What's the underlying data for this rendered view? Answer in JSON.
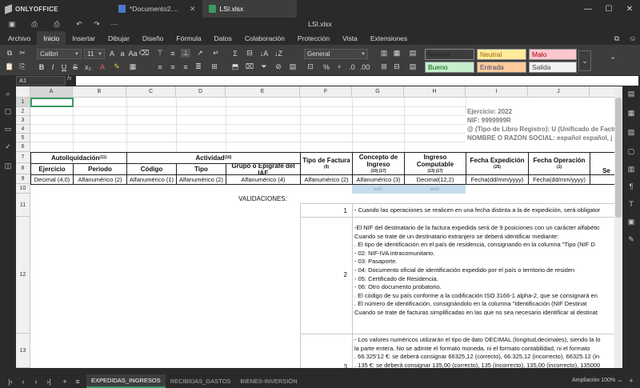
{
  "app": {
    "name": "ONLYOFFICE"
  },
  "tabs": [
    {
      "label": "*Documento2....",
      "active": false,
      "color": "#4a78c8"
    },
    {
      "label": "LSI.xlsx",
      "active": true,
      "color": "#3a9a5f"
    }
  ],
  "document_title": "LSI.xlsx",
  "menu": [
    "Archivo",
    "Inicio",
    "Insertar",
    "Dibujar",
    "Diseño",
    "Fórmula",
    "Datos",
    "Colaboración",
    "Protección",
    "Vista",
    "Extensiones"
  ],
  "menu_active": "Inicio",
  "ribbon": {
    "font_name": "Calibri",
    "font_size": "11",
    "number_format": "General",
    "styles": [
      {
        "label": "Normal",
        "bg": "#ffffff"
      },
      {
        "label": "Neutral",
        "bg": "#ffeb9c"
      },
      {
        "label": "Malo",
        "bg": "#ffc7ce"
      },
      {
        "label": "Bueno",
        "bg": "#c6efce"
      },
      {
        "label": "Entrada",
        "bg": "#ffcc99"
      },
      {
        "label": "Salida",
        "bg": "#f2f2f2"
      }
    ]
  },
  "formula_bar": {
    "name_box": "A1",
    "fx": "fx",
    "value": ""
  },
  "columns": [
    "A",
    "B",
    "C",
    "D",
    "E",
    "F",
    "G",
    "H",
    "I",
    "J"
  ],
  "rows": [
    "1",
    "2",
    "3",
    "4",
    "5",
    "6",
    "7",
    "8",
    "9",
    "10",
    "11",
    "12",
    "13"
  ],
  "sheet": {
    "info": {
      "ejercicio": "Ejercicio: 2022",
      "nif": "NIF: 9999999R",
      "tipo_libro": "@ (Tipo de Libro Registro): U (Unificado de Factu",
      "nombre": "NOMBRE O RAZÓN SOCIAL: español español, j"
    },
    "groups": {
      "autoliquidacion": "Autoliquidación",
      "autoliquidacion_sup": "(11)",
      "actividad": "Actividad",
      "actividad_sup": "(16)"
    },
    "headers": {
      "tipo_factura": "Tipo de Factura",
      "tipo_factura_sup": "(9)",
      "concepto": "Concepto de Ingreso",
      "concepto_sup": "(10) (17)",
      "ingreso": "Ingreso Computable",
      "ingreso_sup": "(13) (17)",
      "fecha_exp": "Fecha Expedición",
      "fecha_exp_sup": "(25)",
      "fecha_op": "Fecha Operación",
      "fecha_op_sup": "(1)",
      "ejercicio": "Ejercicio",
      "periodo": "Periodo",
      "codigo": "Código",
      "tipo": "Tipo",
      "grupo": "Grupo o Epígrafe del IAE",
      "cut": "Se"
    },
    "formats": [
      "Decimal (4,0)",
      "Alfanumérico (2)",
      "Alfanumérico (1)",
      "Alfanumérico (2)",
      "Alfanumérico (4)",
      "Alfanumérico (2)",
      "Alfanumérico (3)",
      "Decimal(12,2)",
      "Fecha(dd/mm/yyyy)",
      "Fecha(dd/mm/yyyy)"
    ],
    "row10": [
      "auto",
      "auto"
    ],
    "validaciones": "VALIDACIONES:",
    "v_numbers": [
      "1",
      "2",
      "3"
    ],
    "v1": "- Cuando las operaciones se realicen en una fecha distinta a la de expedición, será obligator",
    "v2": [
      "-El NIF del destinatario de la factura expedida será de 9 posiciones con un carácter alfabétic",
      "Cuando se trate de un destinatario extranjero se deberá identificar mediante:",
      "   . El tipo de identificación en el país de residencia, consignando en la columna \"Tipo (NIF D",
      "            - 02: NIF-IVA intracomunitario.",
      "            - 03: Pasaporte.",
      "            - 04: Documento oficial de identificación expedido por el país o territorio de residen",
      "            - 05: Certificado de Residencia.",
      "            - 06: Otro documento probatorio.",
      "   . El código de su país conforme a la codificación ISO 3166-1 alpha-2, que se consignará en",
      "   . El número de identificación, consignándolo en la columna  \"Identificación (NIF Destinat",
      "Cuando se trate de facturas simplificadas en las que no sea necesario identificar al destinat"
    ],
    "v3": [
      "- Los valores numéricos utilizarán el tipo de dato DECIMAL (longitud,decimales), siendo la lo",
      "la parte entera. No se admite el formato moneda, ni el formato contabilidad, ni el formato",
      "  . 66.325'12 €: se deberá consignar 66325,12 (correcto), 66.325,12 (incorrecto), 66325.12 (in",
      "  . 135 €: se deberá consignar 135,00 (correcto), 135 (incorrecto), 135,00 (incorrecto), 135000"
    ]
  },
  "sheet_tabs": [
    "EXPEDIDAS_INGRESOS",
    "RECIBIDAS_GASTOS",
    "BIENES-INVERSIÓN"
  ],
  "sheet_tab_active": "EXPEDIDAS_INGRESOS",
  "zoom_label": "Ampliación 100%"
}
